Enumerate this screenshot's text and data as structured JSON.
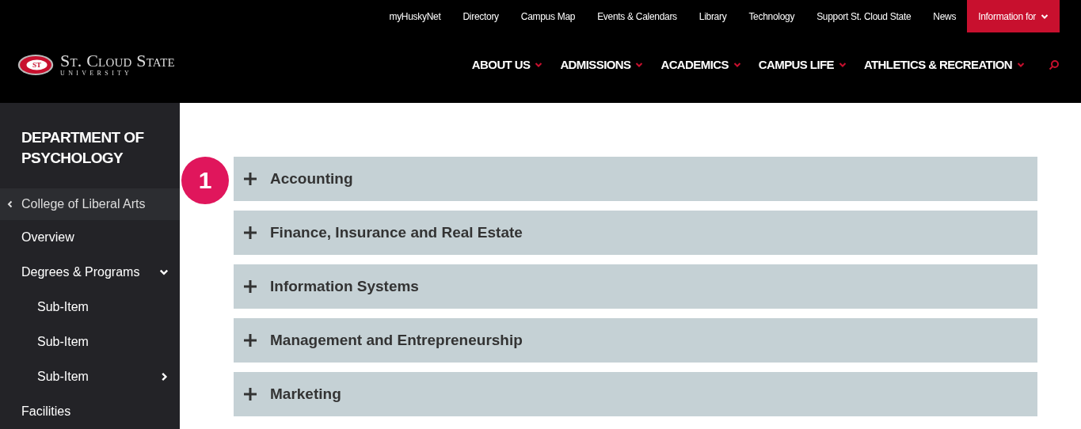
{
  "header": {
    "logo": {
      "emblem_text": "ST",
      "name": "St. Cloud State",
      "subtitle": "U N I V E R S I T Y"
    },
    "utility_links": [
      {
        "label": "myHuskyNet"
      },
      {
        "label": "Directory"
      },
      {
        "label": "Campus Map"
      },
      {
        "label": "Events & Calendars"
      },
      {
        "label": "Library"
      },
      {
        "label": "Technology"
      },
      {
        "label": "Support St. Cloud State"
      },
      {
        "label": "News"
      }
    ],
    "info_button": {
      "label": "Information for",
      "expanded": false
    },
    "main_nav": [
      {
        "label": "ABOUT US",
        "expanded": false
      },
      {
        "label": "ADMISSIONS",
        "expanded": false
      },
      {
        "label": "ACADEMICS",
        "expanded": false
      },
      {
        "label": "CAMPUS LIFE",
        "expanded": false
      },
      {
        "label": "ATHLETICS & RECREATION",
        "expanded": false
      }
    ]
  },
  "sidebar": {
    "title": "DEPARTMENT OF PSYCHOLOGY",
    "back_link": {
      "label": "College of Liberal Arts"
    },
    "items": [
      {
        "label": "Overview"
      },
      {
        "label": "Degrees & Programs",
        "expanded": true,
        "children": [
          {
            "label": "Sub-Item"
          },
          {
            "label": "Sub-Item"
          },
          {
            "label": "Sub-Item",
            "expanded": false
          }
        ]
      },
      {
        "label": "Facilities"
      }
    ]
  },
  "callout": {
    "label": "1"
  },
  "accordion": [
    {
      "label": "Accounting",
      "expanded": false
    },
    {
      "label": "Finance, Insurance and Real Estate",
      "expanded": false
    },
    {
      "label": "Information Systems",
      "expanded": false
    },
    {
      "label": "Management and Entrepreneurship",
      "expanded": false
    },
    {
      "label": "Marketing",
      "expanded": false
    }
  ]
}
